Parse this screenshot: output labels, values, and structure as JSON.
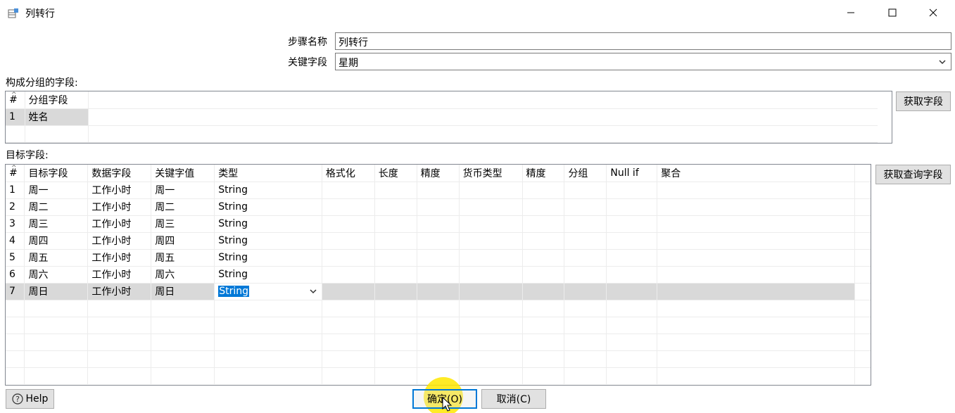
{
  "window": {
    "title": "列转行",
    "icon": "app-table-icon",
    "controls": [
      "minimize-icon",
      "maximize-icon",
      "close-icon"
    ]
  },
  "form": {
    "step_name_label": "步骤名称",
    "step_name_value": "列转行",
    "key_field_label": "关键字段",
    "key_field_value": "星期"
  },
  "group_section": {
    "label": "构成分组的字段:",
    "headers": [
      "#",
      "分组字段"
    ],
    "rows": [
      {
        "idx": "1",
        "field": "姓名"
      }
    ],
    "get_fields_button": "获取字段"
  },
  "target_section": {
    "label": "目标字段:",
    "headers": [
      "#",
      "目标字段",
      "数据字段",
      "关键字值",
      "类型",
      "格式化",
      "长度",
      "精度",
      "货币类型",
      "精度",
      "分组",
      "Null if",
      "聚合"
    ],
    "rows": [
      {
        "idx": "1",
        "target": "周一",
        "data": "工作小时",
        "key": "周一",
        "type": "String"
      },
      {
        "idx": "2",
        "target": "周二",
        "data": "工作小时",
        "key": "周二",
        "type": "String"
      },
      {
        "idx": "3",
        "target": "周三",
        "data": "工作小时",
        "key": "周三",
        "type": "String"
      },
      {
        "idx": "4",
        "target": "周四",
        "data": "工作小时",
        "key": "周四",
        "type": "String"
      },
      {
        "idx": "5",
        "target": "周五",
        "data": "工作小时",
        "key": "周五",
        "type": "String"
      },
      {
        "idx": "6",
        "target": "周六",
        "data": "工作小时",
        "key": "周六",
        "type": "String"
      },
      {
        "idx": "7",
        "target": "周日",
        "data": "工作小时",
        "key": "周日",
        "type": "String"
      }
    ],
    "get_lookup_fields_button": "获取查询字段"
  },
  "footer": {
    "help_label": "Help",
    "ok_label": "确定(O)",
    "cancel_label": "取消(C)"
  },
  "colors": {
    "selection": "#0078d7",
    "selected_row": "#d9d9d9",
    "cursor_highlight": "#ffe800"
  }
}
